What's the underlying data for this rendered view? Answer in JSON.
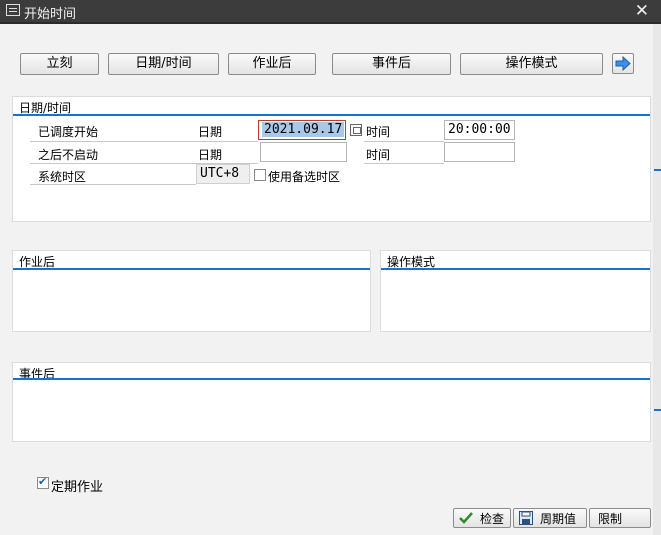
{
  "window": {
    "title": "开始时间"
  },
  "toolbar": {
    "buttons": [
      "立刻",
      "日期/时间",
      "作业后",
      "事件后",
      "操作模式"
    ]
  },
  "datetime_panel": {
    "title": "日期/时间",
    "scheduled_start_label": "已调度开始",
    "date_label": "日期",
    "date_value": "2021.09.17",
    "time_label": "时间",
    "time_value": "20:00:00",
    "no_start_after_label": "之后不启动",
    "date_label_2": "日期",
    "time_label_2": "时间",
    "date_value_2": "",
    "time_value_2": "",
    "system_tz_label": "系统时区",
    "tz_value": "UTC+8",
    "use_alt_tz_label": "使用备选时区"
  },
  "after_job_panel": {
    "title": "作业后"
  },
  "op_mode_panel": {
    "title": "操作模式"
  },
  "after_event_panel": {
    "title": "事件后"
  },
  "periodic": {
    "label": "定期作业",
    "checked": true
  },
  "bottom": {
    "check_label": "检查",
    "period_label": "周期值",
    "restrict_label": "限制"
  }
}
